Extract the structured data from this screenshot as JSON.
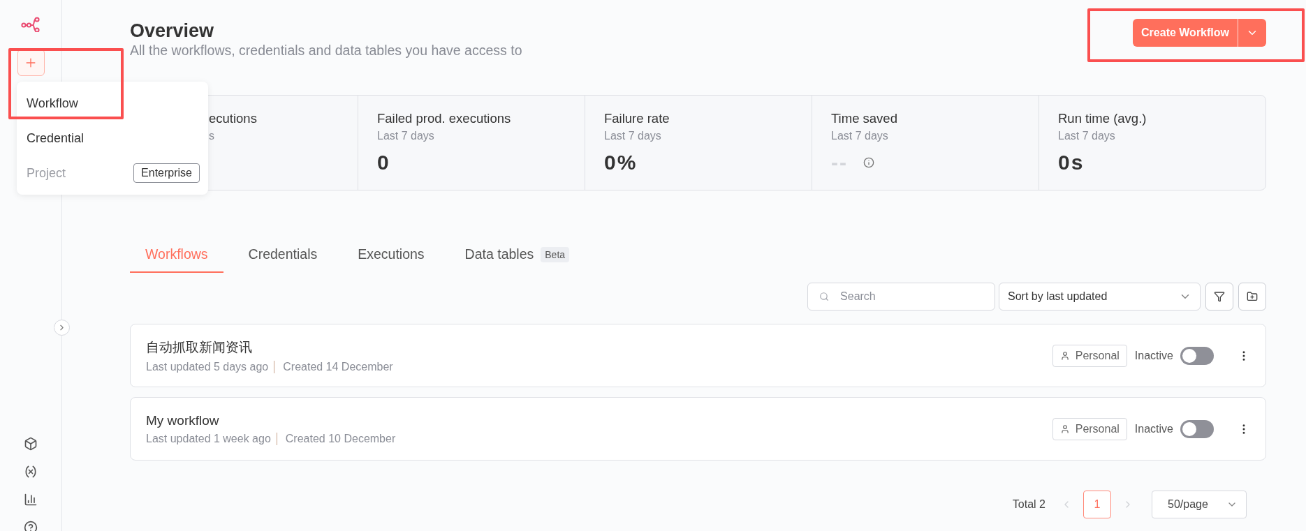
{
  "new_menu": {
    "highlighted": true,
    "items": [
      {
        "label": "Workflow",
        "disabled": false
      },
      {
        "label": "Credential",
        "disabled": false
      },
      {
        "label": "Project",
        "disabled": true,
        "badge": "Enterprise"
      }
    ]
  },
  "header": {
    "title": "Overview",
    "subtitle": "All the workflows, credentials and data tables you have access to",
    "create_button": {
      "label": "Create Workflow",
      "highlighted": true
    }
  },
  "stats": [
    {
      "label": "ecutions",
      "period": "s",
      "covered": true
    },
    {
      "label": "Failed prod. executions",
      "period": "Last 7 days",
      "value": "0",
      "muted": false,
      "info": false,
      "covered": false
    },
    {
      "label": "Failure rate",
      "period": "Last 7 days",
      "value": "0%",
      "muted": false,
      "info": false,
      "covered": false
    },
    {
      "label": "Time saved",
      "period": "Last 7 days",
      "value": "--",
      "muted": true,
      "info": true,
      "covered": false
    },
    {
      "label": "Run time (avg.)",
      "period": "Last 7 days",
      "value": "0s",
      "muted": false,
      "info": false,
      "covered": false
    }
  ],
  "tabs": [
    {
      "label": "Workflows",
      "selected": true
    },
    {
      "label": "Credentials",
      "selected": false
    },
    {
      "label": "Executions",
      "selected": false
    },
    {
      "label": "Data tables",
      "selected": false,
      "badge": "Beta"
    }
  ],
  "toolbar": {
    "search": {
      "placeholder": "Search"
    },
    "sort": {
      "value": "Sort by last updated"
    }
  },
  "workflows": [
    {
      "name": "自动抓取新闻资讯",
      "updated": "Last updated 5 days ago",
      "created": "Created 14 December",
      "owner": "Personal",
      "status": "Inactive",
      "active": false
    },
    {
      "name": "My workflow",
      "updated": "Last updated 1 week ago",
      "created": "Created 10 December",
      "owner": "Personal",
      "status": "Inactive",
      "active": false
    }
  ],
  "pagination": {
    "total": "Total 2",
    "prev_disabled": true,
    "next_disabled": true,
    "pages": [
      {
        "label": "1",
        "selected": true
      }
    ],
    "page_size": "50/page"
  }
}
